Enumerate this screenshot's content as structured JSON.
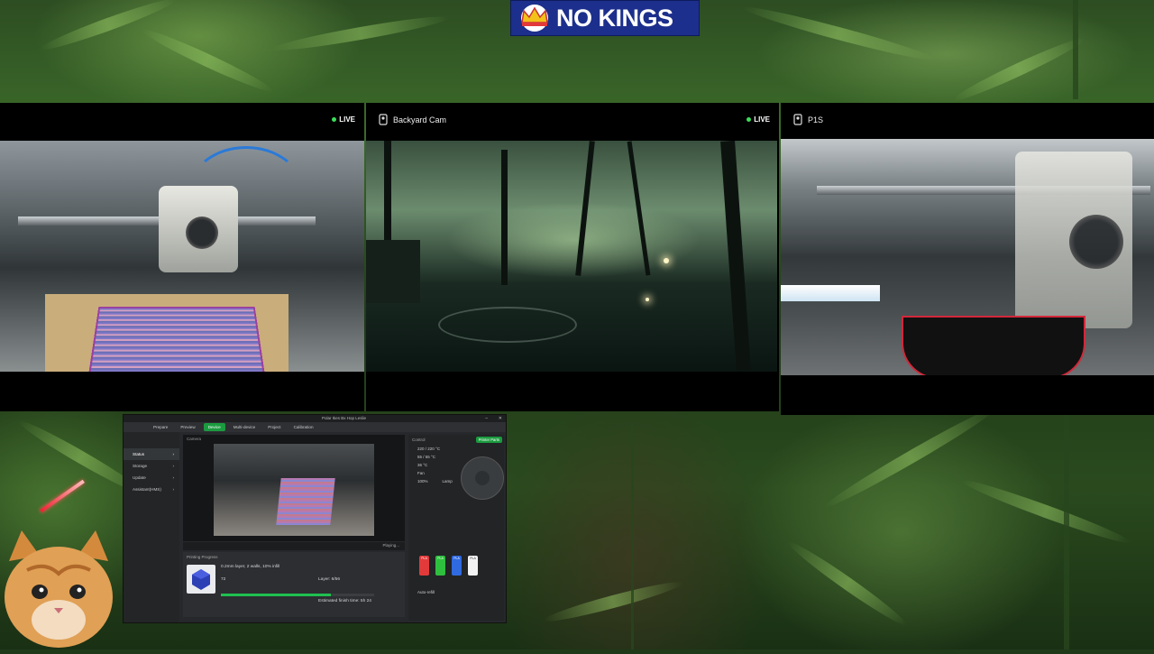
{
  "banner": {
    "text": "NO KINGS"
  },
  "cameras": [
    {
      "title": "",
      "live": "LIVE"
    },
    {
      "title": "Backyard Cam",
      "live": "LIVE"
    },
    {
      "title": "P1S",
      "live": ""
    }
  ],
  "app": {
    "window_title": "Polar Ikes Bx Hop Leslie",
    "menu": [
      "Prepare",
      "Preview",
      "Device",
      "Multi-device",
      "Project",
      "Calibration"
    ],
    "active_menu": "Device",
    "sidebar": [
      "Status",
      "Storage",
      "Update",
      "Assistant(HMS)"
    ],
    "video_header": "Camera",
    "playing": "Playing...",
    "progress_header": "Printing Progress",
    "job": "0.2mm layer, 2 walls, 10% infill",
    "layer": "Layer: 6/56",
    "percent": "72",
    "estimated": "Estimated finish time: 5h 24",
    "progress_fraction": 0.72,
    "control_header": "Control",
    "printer_parts": "Printer Parts",
    "temps": [
      "220 / 220 °C",
      "55 / 55 °C",
      "36 °C"
    ],
    "fan": "Fan",
    "lamp": "Lamp",
    "speed": "100%",
    "auto_refill": "Auto-refill",
    "spools": [
      {
        "label": "PLA",
        "color": "#e23a3a"
      },
      {
        "label": "PLA",
        "color": "#2fbf3f"
      },
      {
        "label": "PLA",
        "color": "#2f6ae0"
      },
      {
        "label": "PLA",
        "color": "#f2f2f2"
      }
    ]
  }
}
